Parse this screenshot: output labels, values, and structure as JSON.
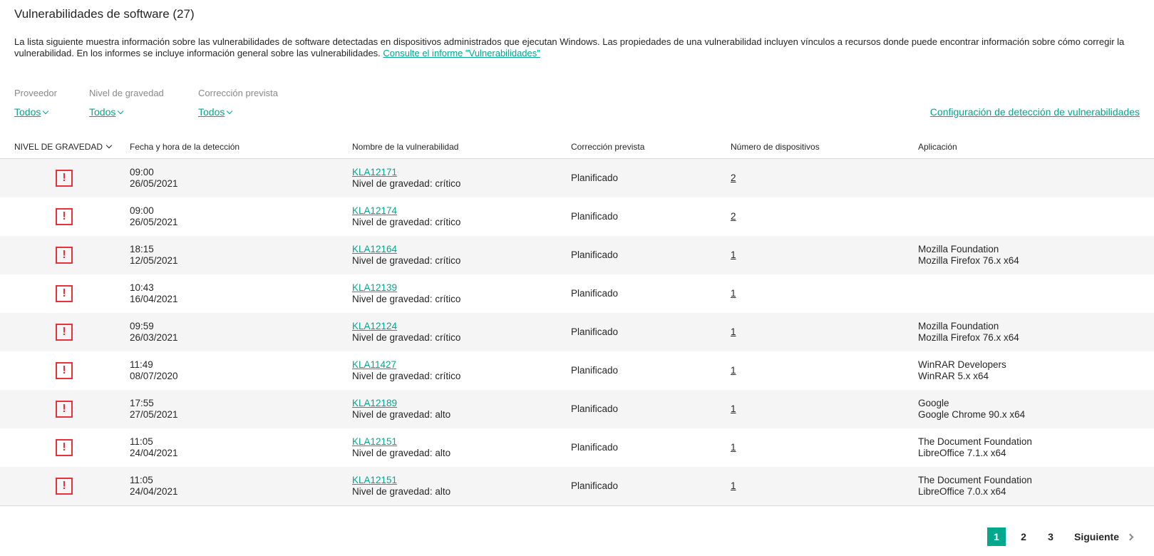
{
  "header": {
    "title": "Vulnerabilidades de software (27)",
    "description": "La lista siguiente muestra información sobre las vulnerabilidades de software detectadas en dispositivos administrados que ejecutan Windows. Las propiedades de una vulnerabilidad incluyen vínculos a recursos donde puede encontrar información sobre cómo corregir la vulnerabilidad. En los informes se incluye información general sobre las vulnerabilidades.",
    "report_link": "Consulte el informe \"Vulnerabilidades\""
  },
  "filters": [
    {
      "label": "Proveedor",
      "value": "Todos"
    },
    {
      "label": "Nivel de gravedad",
      "value": "Todos"
    },
    {
      "label": "Corrección prevista",
      "value": "Todos"
    }
  ],
  "config_link": "Configuración de detección de vulnerabilidades",
  "table": {
    "columns": {
      "severity": "NIVEL DE GRAVEDAD",
      "date": "Fecha y hora de la detección",
      "name": "Nombre de la vulnerabilidad",
      "fix": "Corrección prevista",
      "count": "Número de dispositivos",
      "app": "Aplicación"
    },
    "rows": [
      {
        "time": "09:00",
        "date": "26/05/2021",
        "id": "KLA12171",
        "severity": "Nivel de gravedad: crítico",
        "fix": "Planificado",
        "count": "2",
        "vendor": "",
        "app": ""
      },
      {
        "time": "09:00",
        "date": "26/05/2021",
        "id": "KLA12174",
        "severity": "Nivel de gravedad: crítico",
        "fix": "Planificado",
        "count": "2",
        "vendor": "",
        "app": ""
      },
      {
        "time": "18:15",
        "date": "12/05/2021",
        "id": "KLA12164",
        "severity": "Nivel de gravedad: crítico",
        "fix": "Planificado",
        "count": "1",
        "vendor": "Mozilla Foundation",
        "app": "Mozilla Firefox 76.x x64"
      },
      {
        "time": "10:43",
        "date": "16/04/2021",
        "id": "KLA12139",
        "severity": "Nivel de gravedad: crítico",
        "fix": "Planificado",
        "count": "1",
        "vendor": "",
        "app": ""
      },
      {
        "time": "09:59",
        "date": "26/03/2021",
        "id": "KLA12124",
        "severity": "Nivel de gravedad: crítico",
        "fix": "Planificado",
        "count": "1",
        "vendor": "Mozilla Foundation",
        "app": "Mozilla Firefox 76.x x64"
      },
      {
        "time": "11:49",
        "date": "08/07/2020",
        "id": "KLA11427",
        "severity": "Nivel de gravedad: crítico",
        "fix": "Planificado",
        "count": "1",
        "vendor": "WinRAR Developers",
        "app": "WinRAR 5.x x64"
      },
      {
        "time": "17:55",
        "date": "27/05/2021",
        "id": "KLA12189",
        "severity": "Nivel de gravedad: alto",
        "fix": "Planificado",
        "count": "1",
        "vendor": "Google",
        "app": "Google Chrome 90.x x64"
      },
      {
        "time": "11:05",
        "date": "24/04/2021",
        "id": "KLA12151",
        "severity": "Nivel de gravedad: alto",
        "fix": "Planificado",
        "count": "1",
        "vendor": "The Document Foundation",
        "app": "LibreOffice 7.1.x x64"
      },
      {
        "time": "11:05",
        "date": "24/04/2021",
        "id": "KLA12151",
        "severity": "Nivel de gravedad: alto",
        "fix": "Planificado",
        "count": "1",
        "vendor": "The Document Foundation",
        "app": "LibreOffice 7.0.x x64"
      }
    ]
  },
  "pagination": {
    "pages": [
      "1",
      "2",
      "3"
    ],
    "current": "1",
    "next_label": "Siguiente"
  },
  "icons": {
    "severity": "alert-square-icon",
    "severity_color": "#e8313b",
    "accent_color": "#00a88e"
  }
}
